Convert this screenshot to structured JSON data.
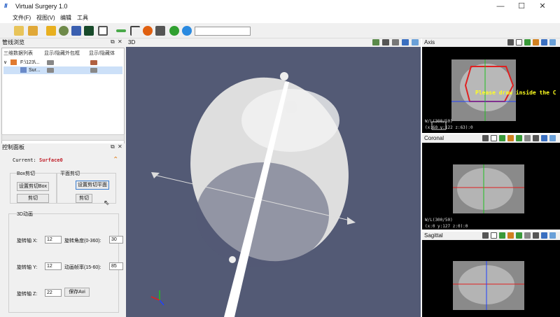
{
  "window": {
    "title": "Virtual Surgery 1.0",
    "minimize": "—",
    "maximize": "☐",
    "close": "✕"
  },
  "menu": [
    "文件(F)",
    "视图(V)",
    "编辑",
    "工具"
  ],
  "pipeline": {
    "title": "管线浏览",
    "col1": "三维数据列表",
    "col2": "显示/隐藏外包框",
    "col3": "显示/隐藏体",
    "row1": "F:\\123\\...",
    "row2": "Sur..."
  },
  "control": {
    "title": "控制面板",
    "current_label": "Current:",
    "current_value": "Surface0",
    "box_group": "Box剪切",
    "plane_group": "平面剪切",
    "set_box": "设置剪切Box",
    "cut1": "剪切",
    "set_plane": "设置剪切平面",
    "cut2": "剪切",
    "anim_group": "3D动画",
    "rx_label": "旋转轴 X:",
    "rx_value": "12",
    "ry_label": "旋转轴 Y:",
    "ry_value": "12",
    "rz_label": "旋转轴 Z:",
    "rz_value": "22",
    "angle_label": "旋转角度(0-360):",
    "angle_value": "30",
    "rate_label": "动画帧率(15-60):",
    "rate_value": "85",
    "save_avi": "保存Avi"
  },
  "view3d": {
    "title": "3D"
  },
  "axis_view": {
    "title": "Axis",
    "message": "Please draw inside the C",
    "wl": "W/L(300/50)",
    "coords": "(x:60 y:122 z:63):0"
  },
  "coronal_view": {
    "title": "Coronal",
    "wl": "W/L(300/50)",
    "coords": "(x:0 y:127 z:0):0"
  },
  "sagittal_view": {
    "title": "Sagittal"
  },
  "colors": {
    "accent": "#2a62c8",
    "viewport": "#535a75",
    "surface": "#e6e6e6",
    "crosshair_red": "#e02020",
    "crosshair_green": "#20c020",
    "crosshair_blue": "#2040ff",
    "message": "#ffff20"
  }
}
